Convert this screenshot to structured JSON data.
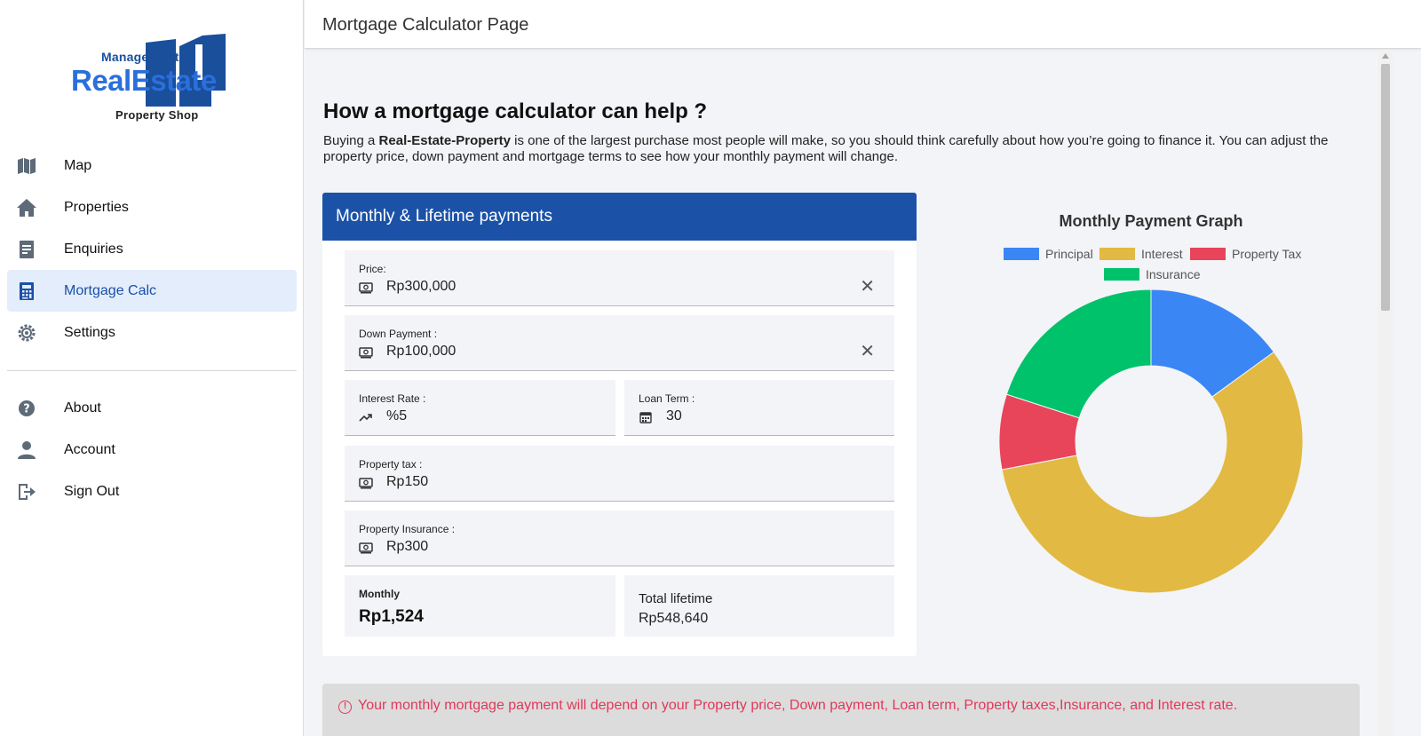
{
  "logo": {
    "top": "Management",
    "main": "RealEstate",
    "bottom": "Property Shop"
  },
  "sidebar": {
    "items": [
      {
        "label": "Map",
        "icon": "map-icon"
      },
      {
        "label": "Properties",
        "icon": "home-icon"
      },
      {
        "label": "Enquiries",
        "icon": "document-icon"
      },
      {
        "label": "Mortgage Calc",
        "icon": "calculator-icon",
        "active": true
      },
      {
        "label": "Settings",
        "icon": "gear-icon"
      }
    ],
    "secondary": [
      {
        "label": "About",
        "icon": "help-icon"
      },
      {
        "label": "Account",
        "icon": "person-icon"
      },
      {
        "label": "Sign Out",
        "icon": "sign-out-icon"
      }
    ]
  },
  "header": {
    "title": "Mortgage Calculator Page"
  },
  "main": {
    "heading": "How a mortgage calculator can help ?",
    "intro_pre": "Buying a ",
    "intro_bold": "Real-Estate-Property",
    "intro_post": " is one of the largest purchase most people will make, so you should think carefully about how you’re going to finance it. You can adjust the property price, down payment and mortgage terms to see how your monthly payment will change."
  },
  "calculator": {
    "title": "Monthly & Lifetime payments",
    "price": {
      "label": "Price:",
      "value": "Rp300,000"
    },
    "down_payment": {
      "label": "Down Payment :",
      "value": "Rp100,000"
    },
    "interest_rate": {
      "label": "Interest Rate :",
      "value": "%5"
    },
    "loan_term": {
      "label": "Loan Term :",
      "value": "30"
    },
    "property_tax": {
      "label": "Property tax :",
      "value": "Rp150"
    },
    "property_insurance": {
      "label": "Property Insurance :",
      "value": "Rp300"
    },
    "monthly": {
      "label": "Monthly",
      "value": "Rp1,524"
    },
    "lifetime": {
      "label": "Total lifetime",
      "value": "Rp548,640"
    }
  },
  "colors": {
    "accent": "#1b52a8",
    "principal": "#3b86f5",
    "interest": "#e2b942",
    "property_tax": "#e8445a",
    "insurance": "#00c26b",
    "notice": "#e0385a"
  },
  "chart_data": {
    "type": "pie",
    "title": "Monthly Payment Graph",
    "categories": [
      "Principal",
      "Interest",
      "Property Tax",
      "Insurance"
    ],
    "values": [
      150,
      570,
      80,
      200
    ],
    "colors": [
      "#3b86f5",
      "#e2b942",
      "#e8445a",
      "#00c26b"
    ],
    "legend": "top"
  },
  "notice": {
    "text": "Your monthly mortgage payment will depend on your Property price, Down payment, Loan term, Property taxes,Insurance, and Interest rate."
  }
}
